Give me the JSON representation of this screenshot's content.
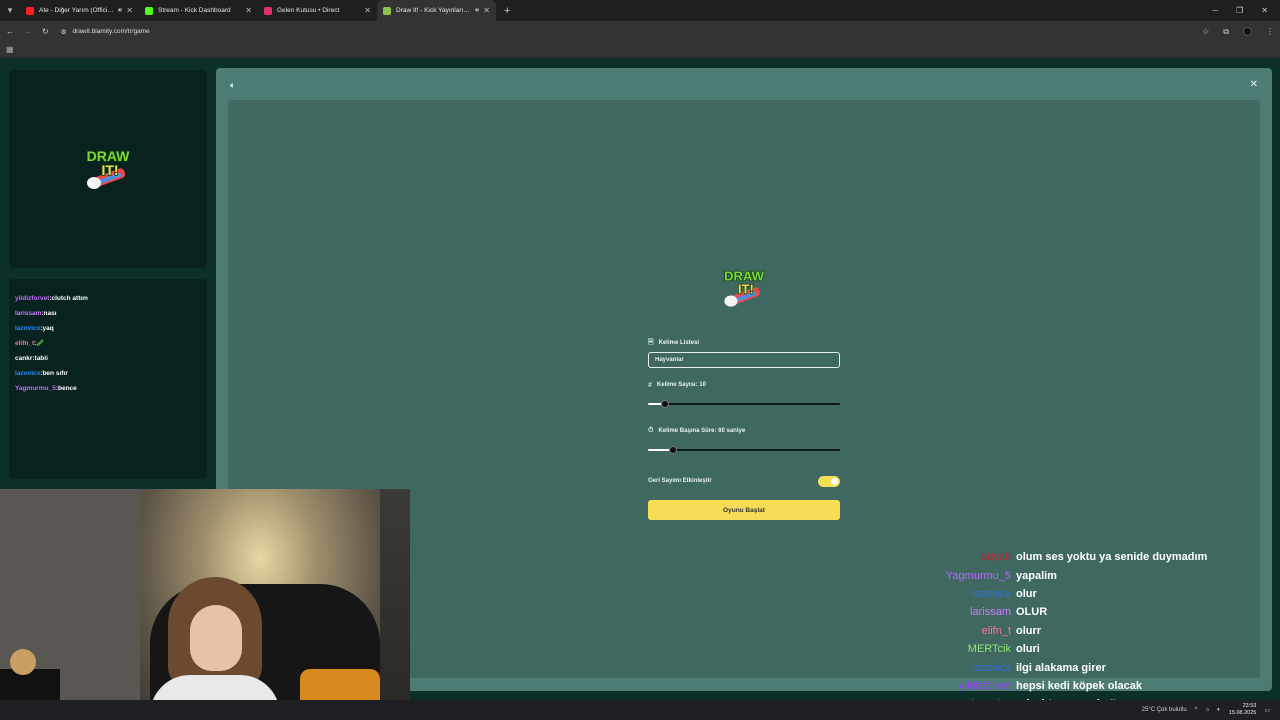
{
  "browser": {
    "tabs": [
      {
        "label": "Ate - Diğer Yarım (Official V",
        "favicon_color": "#ff2020",
        "active": false,
        "sound": true
      },
      {
        "label": "Stream - Kick Dashboard",
        "favicon_color": "#53fc18",
        "active": false,
        "sound": false
      },
      {
        "label": "Gelen Kutusu • Direct",
        "favicon_color": "#e1306c",
        "active": false,
        "sound": false
      },
      {
        "label": "Draw It! - Kick Yayınları İçin",
        "favicon_color": "#8bc34a",
        "active": true,
        "sound": true
      }
    ],
    "new_tab": "+",
    "url": "drawit.blamity.com/tr/game"
  },
  "left": {
    "chat": [
      {
        "user": "yildizforvet",
        "color": "#c86bff",
        "msg": ":clutch attım"
      },
      {
        "user": "larissam",
        "color": "#d07cff",
        "msg": ":nası"
      },
      {
        "user": "lazovicx",
        "color": "#2f8cff",
        "msg": ":yaq"
      },
      {
        "user": "elifn_t",
        "color": "#ff6fa1",
        "msg": ":🥒"
      },
      {
        "user": "cankr",
        "color": "#ffffff",
        "msg": ":tabii"
      },
      {
        "user": "lazovicx",
        "color": "#2f8cff",
        "msg": ":ben sıfır"
      },
      {
        "user": "Yagmurmu_5",
        "color": "#c86bff",
        "msg": ":bence"
      }
    ]
  },
  "game": {
    "word_list_label": "Kelime Listesi",
    "word_list_placeholder": "Hayvanlar",
    "word_count_label": "Kelime Sayısı: 10",
    "word_count_pct": 9,
    "time_label": "Kelime Başına Süre: 60 saniye",
    "time_pct": 13,
    "countdown_label": "Geri Sayımı Etkinleştir",
    "countdown_enabled": true,
    "start_label": "Oyunu Başlat",
    "logo_line1": "DRAW",
    "logo_line2": "IT!",
    "accent": "#f5de55"
  },
  "overlay_chat": [
    {
      "user": "odyah",
      "color": "#c8202a",
      "msg": "olum ses yoktu ya senide duymadım"
    },
    {
      "user": "Yagmurmu_5",
      "color": "#b866ff",
      "msg": "yapalim"
    },
    {
      "user": "lazovicx",
      "color": "#2f6fd8",
      "msg": "olur"
    },
    {
      "user": "larissam",
      "color": "#d07cff",
      "msg": "OLUR"
    },
    {
      "user": "elifn_t",
      "color": "#ff6fa1",
      "msg": "olurr"
    },
    {
      "user": "MERTcik",
      "color": "#8fe36a",
      "msg": "oluri"
    },
    {
      "user": "lazovicx",
      "color": "#2f6fd8",
      "msg": "ilgi alakama girer"
    },
    {
      "user": "yildizforvet",
      "color": "#9a3cff",
      "msg": "hepsi kedi köpek olacak"
    },
    {
      "user": "lazovicx",
      "color": "#2f6fd8",
      "msg": "odyahtan severimö"
    }
  ],
  "taskbar": {
    "weather": "25°C Çok bulutlu",
    "time": "23:53",
    "date": "15.08.2025"
  }
}
